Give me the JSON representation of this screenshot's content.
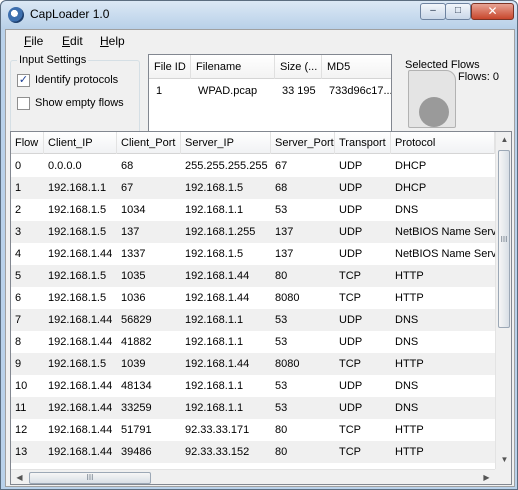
{
  "window": {
    "title": "CapLoader 1.0",
    "min_label": "–",
    "max_label": "□",
    "close_label": "✕"
  },
  "menu": {
    "items": [
      "File",
      "Edit",
      "Help"
    ]
  },
  "input_settings": {
    "label": "Input Settings",
    "identify_protocols": {
      "label": "Identify protocols",
      "checked": true
    },
    "show_empty_flows": {
      "label": "Show empty flows",
      "checked": false
    }
  },
  "files": {
    "columns": [
      "File ID",
      "Filename",
      "Size (...",
      "MD5"
    ],
    "rows": [
      [
        "1",
        "WPAD.pcap",
        "33 195",
        "733d96c17..."
      ]
    ]
  },
  "selected_flows": {
    "label": "Selected Flows",
    "count_text": "Flows: 0"
  },
  "flows": {
    "columns": [
      "Flow",
      "Client_IP",
      "Client_Port",
      "Server_IP",
      "Server_Port",
      "Transport",
      "Protocol"
    ],
    "rows": [
      [
        "0",
        "0.0.0.0",
        "68",
        "255.255.255.255",
        "67",
        "UDP",
        "DHCP"
      ],
      [
        "1",
        "192.168.1.1",
        "67",
        "192.168.1.5",
        "68",
        "UDP",
        "DHCP"
      ],
      [
        "2",
        "192.168.1.5",
        "1034",
        "192.168.1.1",
        "53",
        "UDP",
        "DNS"
      ],
      [
        "3",
        "192.168.1.5",
        "137",
        "192.168.1.255",
        "137",
        "UDP",
        "NetBIOS Name Servic"
      ],
      [
        "4",
        "192.168.1.44",
        "1337",
        "192.168.1.5",
        "137",
        "UDP",
        "NetBIOS Name Servic"
      ],
      [
        "5",
        "192.168.1.5",
        "1035",
        "192.168.1.44",
        "80",
        "TCP",
        "HTTP"
      ],
      [
        "6",
        "192.168.1.5",
        "1036",
        "192.168.1.44",
        "8080",
        "TCP",
        "HTTP"
      ],
      [
        "7",
        "192.168.1.44",
        "56829",
        "192.168.1.1",
        "53",
        "UDP",
        "DNS"
      ],
      [
        "8",
        "192.168.1.44",
        "41882",
        "192.168.1.1",
        "53",
        "UDP",
        "DNS"
      ],
      [
        "9",
        "192.168.1.5",
        "1039",
        "192.168.1.44",
        "8080",
        "TCP",
        "HTTP"
      ],
      [
        "10",
        "192.168.1.44",
        "48134",
        "192.168.1.1",
        "53",
        "UDP",
        "DNS"
      ],
      [
        "11",
        "192.168.1.44",
        "33259",
        "192.168.1.1",
        "53",
        "UDP",
        "DNS"
      ],
      [
        "12",
        "192.168.1.44",
        "51791",
        "92.33.33.171",
        "80",
        "TCP",
        "HTTP"
      ],
      [
        "13",
        "192.168.1.44",
        "39486",
        "92.33.33.152",
        "80",
        "TCP",
        "HTTP"
      ]
    ]
  },
  "scroll": {
    "left_arrow": "◀",
    "right_arrow": "▶",
    "up_arrow": "▲",
    "down_arrow": "▼",
    "grip": "III"
  }
}
